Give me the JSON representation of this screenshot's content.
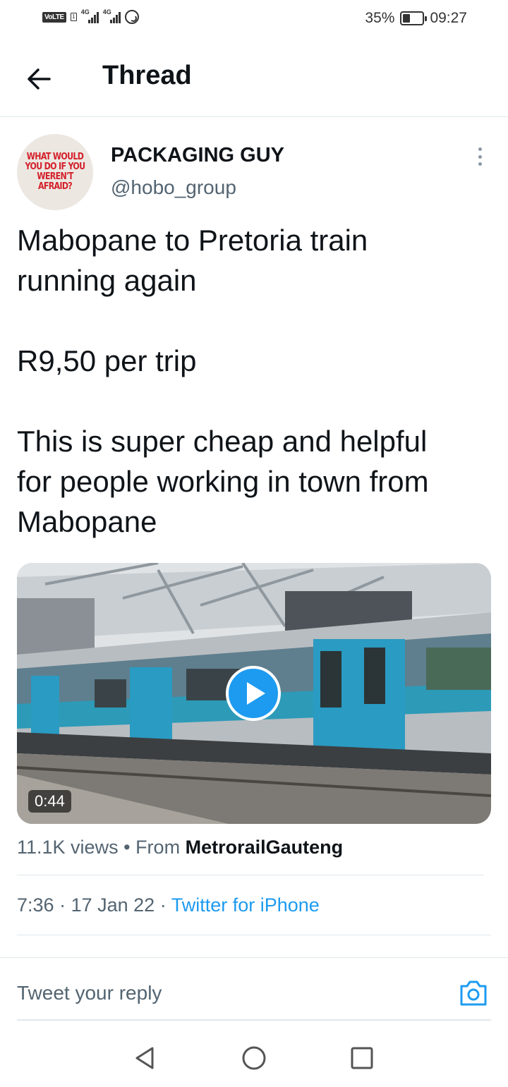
{
  "status_bar": {
    "volte": "VoLTE",
    "sim": "1",
    "net1": "4G",
    "net2": "4G",
    "battery": "35%",
    "time": "09:27"
  },
  "header": {
    "title": "Thread",
    "back_icon": "arrow-left-icon"
  },
  "tweet": {
    "avatar_text": "WHAT WOULD YOU DO IF YOU WEREN'T AFRAID?",
    "display_name": "PACKAGING GUY",
    "handle": "@hobo_group",
    "text": "Mabopane to Pretoria train\nrunning again\n\nR9,50 per trip\n\nThis is super cheap and helpful\nfor people working in town from\nMabopane",
    "video": {
      "duration": "0:44",
      "play_icon": "play-icon"
    },
    "views": "11.1K views",
    "from_prefix": "From",
    "from_source": "MetrorailGauteng",
    "time": "7:36",
    "date": "17 Jan 22",
    "client": "Twitter for iPhone"
  },
  "reply": {
    "placeholder": "Tweet your reply",
    "camera_icon": "camera-icon"
  },
  "colors": {
    "accent": "#1d9bf0",
    "text_primary": "#0f1419",
    "text_secondary": "#536471",
    "divider": "#e1e8ed"
  }
}
